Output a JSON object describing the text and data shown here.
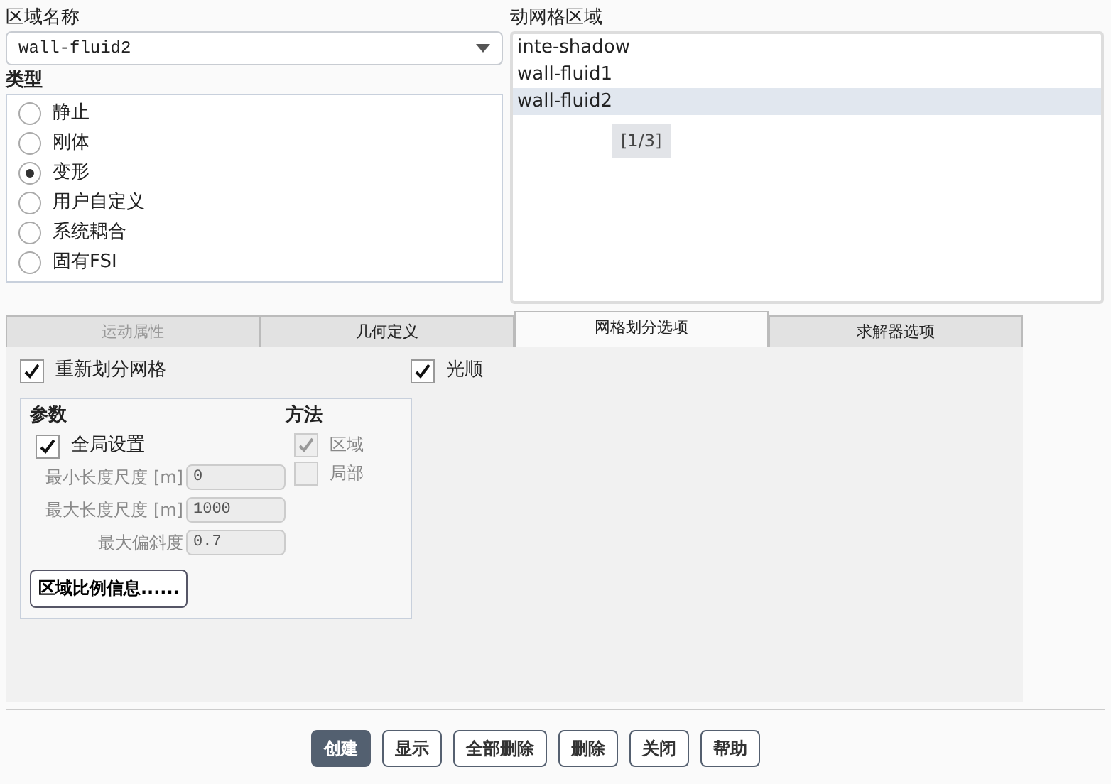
{
  "zone_name": {
    "label": "区域名称",
    "value": "wall-fluid2"
  },
  "type": {
    "label": "类型",
    "options": [
      {
        "label": "静止",
        "selected": false
      },
      {
        "label": "刚体",
        "selected": false
      },
      {
        "label": "变形",
        "selected": true
      },
      {
        "label": "用户自定义",
        "selected": false
      },
      {
        "label": "系统耦合",
        "selected": false
      },
      {
        "label": "固有FSI",
        "selected": false
      }
    ]
  },
  "dynamic_zones": {
    "label": "动网格区域",
    "items": [
      {
        "label": "inte-shadow",
        "selected": false
      },
      {
        "label": "wall-fluid1",
        "selected": false
      },
      {
        "label": "wall-fluid2",
        "selected": true
      }
    ],
    "page": "[1/3]"
  },
  "tabs": [
    {
      "label": "运动属性",
      "selected": false,
      "disabled": true
    },
    {
      "label": "几何定义",
      "selected": false,
      "disabled": false
    },
    {
      "label": "网格划分选项",
      "selected": true,
      "disabled": false
    },
    {
      "label": "求解器选项",
      "selected": false,
      "disabled": false
    }
  ],
  "options": [
    {
      "label": "重新划分网格",
      "checked": true
    },
    {
      "label": "光顺",
      "checked": true
    }
  ],
  "parameters": {
    "title": "参数",
    "global": {
      "label": "全局设置",
      "checked": true
    },
    "fields": [
      {
        "label": "最小长度尺度 [m]",
        "value": "0",
        "disabled": true
      },
      {
        "label": "最大长度尺度 [m]",
        "value": "1000",
        "disabled": true
      },
      {
        "label": "最大偏斜度",
        "value": "0.7",
        "disabled": true
      }
    ],
    "info_button": "区域比例信息......"
  },
  "method": {
    "title": "方法",
    "options": [
      {
        "label": "区域",
        "checked": true,
        "disabled": true
      },
      {
        "label": "局部",
        "checked": false,
        "disabled": true
      }
    ]
  },
  "buttons": [
    {
      "label": "创建",
      "primary": true
    },
    {
      "label": "显示",
      "primary": false
    },
    {
      "label": "全部删除",
      "primary": false
    },
    {
      "label": "删除",
      "primary": false
    },
    {
      "label": "关闭",
      "primary": false
    },
    {
      "label": "帮助",
      "primary": false
    }
  ]
}
